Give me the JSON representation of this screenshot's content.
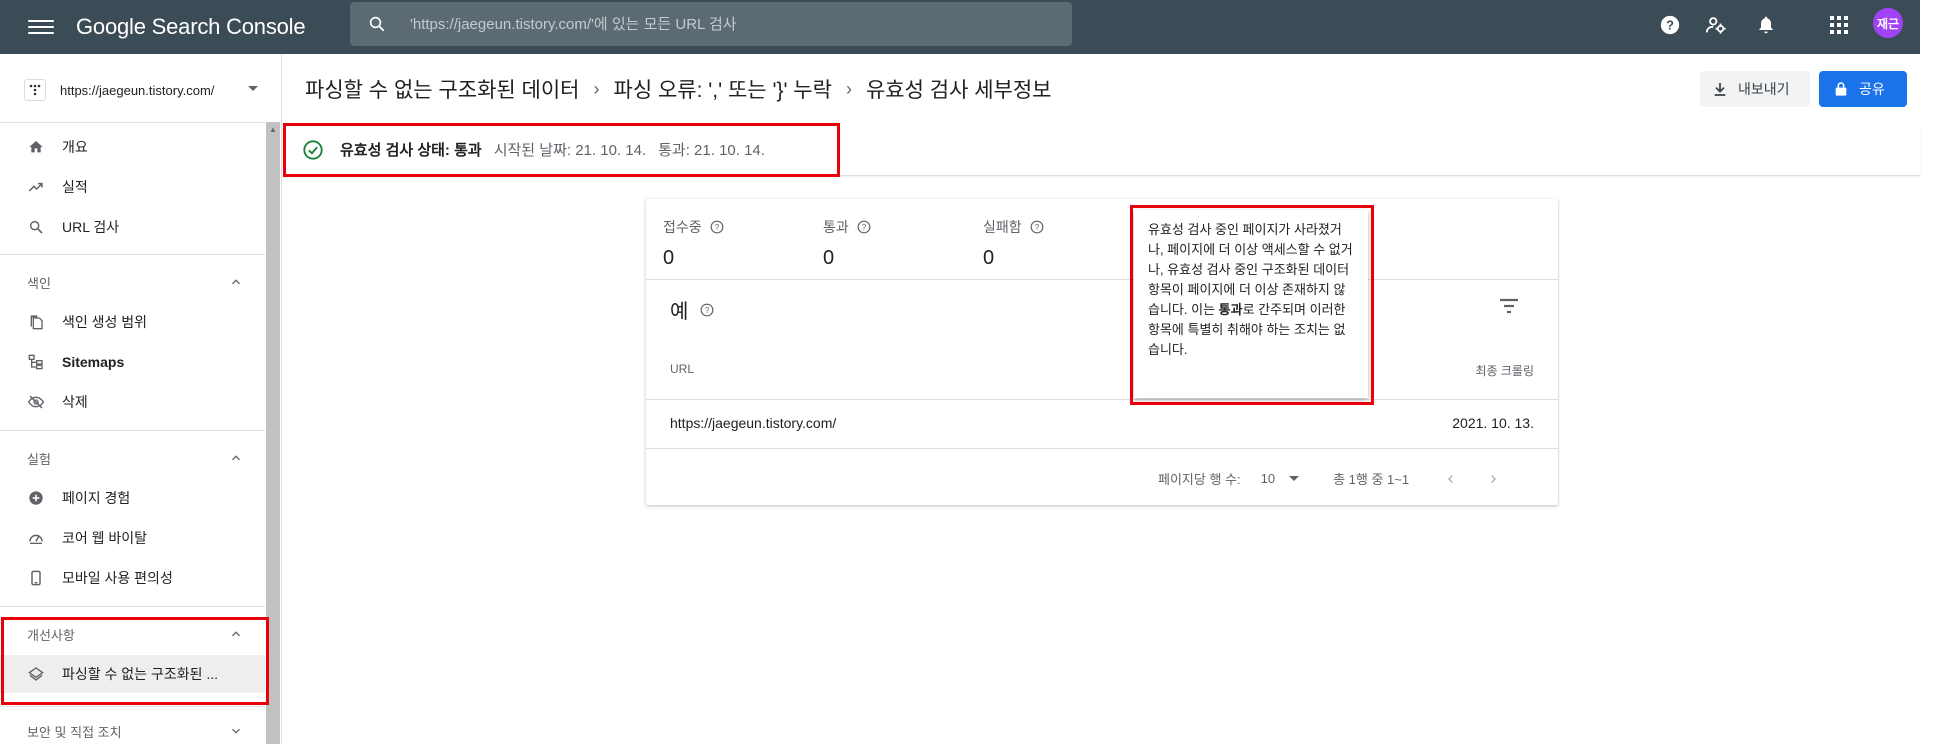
{
  "app": {
    "title": "Google Search Console",
    "search_placeholder": "'https://jaegeun.tistory.com/'에 있는 모든 URL 검사",
    "user_initials": "재근"
  },
  "property": {
    "url": "https://jaegeun.tistory.com/"
  },
  "sidebar": {
    "top_items": [
      {
        "label": "개요",
        "icon": "home-icon"
      },
      {
        "label": "실적",
        "icon": "trending-up-icon"
      },
      {
        "label": "URL 검사",
        "icon": "search-icon"
      }
    ],
    "sections": [
      {
        "title": "색인",
        "items": [
          {
            "label": "색인 생성 범위"
          },
          {
            "label": "Sitemaps"
          },
          {
            "label": "삭제"
          }
        ]
      },
      {
        "title": "실험",
        "items": [
          {
            "label": "페이지 경험"
          },
          {
            "label": "코어 웹 바이탈"
          },
          {
            "label": "모바일 사용 편의성"
          }
        ]
      },
      {
        "title": "개선사항",
        "items": [
          {
            "label": "파싱할 수 없는 구조화된 ..."
          }
        ]
      },
      {
        "title": "보안 및 직접 조치",
        "items": []
      }
    ]
  },
  "breadcrumb": [
    "파싱할 수 없는 구조화된 데이터",
    "파싱 오류: ',' 또는 '}' 누락",
    "유효성 검사 세부정보"
  ],
  "actions": {
    "export_label": "내보내기",
    "share_label": "공유"
  },
  "status": {
    "label": "유효성 검사 상태: 통과",
    "started": "시작된 날짜: 21. 10. 14.",
    "passed": "통과: 21. 10. 14."
  },
  "stats": [
    {
      "label": "접수중",
      "value": "0"
    },
    {
      "label": "통과",
      "value": "0"
    },
    {
      "label": "실패함",
      "value": "0"
    }
  ],
  "examples": {
    "title": "예",
    "columns": {
      "url": "URL",
      "last_crawl": "최종 크롤링"
    },
    "rows": [
      {
        "url": "https://jaegeun.tistory.com/",
        "last_crawl": "2021. 10. 13."
      }
    ],
    "pagination": {
      "rows_per_page_label": "페이지당 행 수:",
      "rows_per_page": "10",
      "range": "총 1행 중 1~1"
    }
  },
  "tooltip": {
    "line1": "유효성 검사 중인 페이지가 사라졌거나, 페이지에 더 이상 액세스할 수 없거나, 유효성 검사 중인 구조화된 데이터 항목이 페이지에 더 이상 존재하지 않습니다.",
    "line2_pre": "이는 ",
    "line2_bold": "통과",
    "line2_post": "로 간주되며 이러한 항목에 특별히 취해야 하는 조치는 없습니다."
  },
  "colors": {
    "topbar": "#3c4c56",
    "accent": "#1a73e8",
    "highlight": "#e8000b",
    "avatar": "#a142f4"
  }
}
